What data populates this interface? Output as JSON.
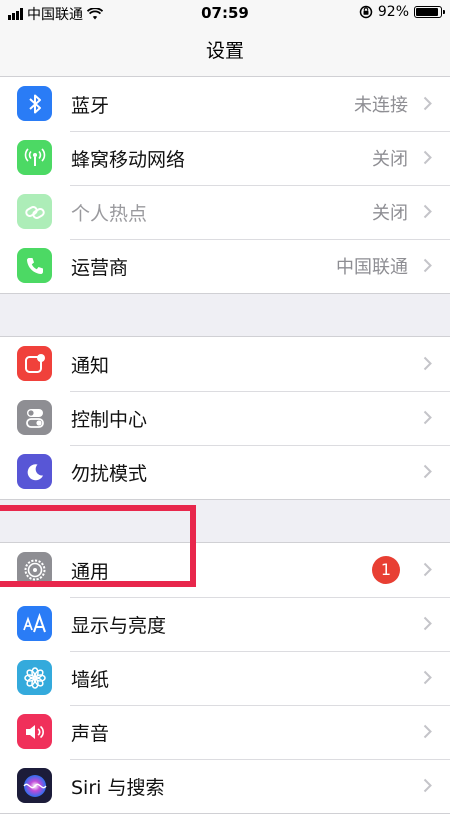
{
  "status": {
    "carrier": "中国联通",
    "time": "07:59",
    "battery": "92%",
    "battery_level": 0.92
  },
  "header": {
    "title": "设置"
  },
  "groups": [
    {
      "items": [
        {
          "label": "蓝牙",
          "value": "未连接",
          "icon": "bluetooth-icon",
          "color": "#2a7cf6"
        },
        {
          "label": "蜂窝移动网络",
          "value": "关闭",
          "icon": "cellular-antenna-icon",
          "color": "#4cd964"
        },
        {
          "label": "个人热点",
          "value": "关闭",
          "icon": "hotspot-chain-icon",
          "color": "#4cd964"
        },
        {
          "label": "运营商",
          "value": "中国联通",
          "icon": "phone-icon",
          "color": "#4cd964"
        }
      ]
    },
    {
      "items": [
        {
          "label": "通知",
          "icon": "notification-icon",
          "color": "#f0413b"
        },
        {
          "label": "控制中心",
          "icon": "toggles-icon",
          "color": "#8e8e93"
        },
        {
          "label": "勿扰模式",
          "icon": "moon-icon",
          "color": "#5856d6"
        }
      ]
    },
    {
      "items": [
        {
          "label": "通用",
          "badge": "1",
          "icon": "gear-icon",
          "color": "#8e8e93"
        },
        {
          "label": "显示与亮度",
          "icon": "text-size-icon",
          "color": "#2a7cf6"
        },
        {
          "label": "墙纸",
          "icon": "flower-icon",
          "color": "#34aadc"
        },
        {
          "label": "声音",
          "icon": "speaker-icon",
          "color": "#f0305a"
        },
        {
          "label": "Siri 与搜索",
          "icon": "siri-icon",
          "color": "#1c1c3a"
        }
      ]
    }
  ],
  "colors": {
    "highlight": "#e8274c",
    "badge": "#e83f33"
  }
}
